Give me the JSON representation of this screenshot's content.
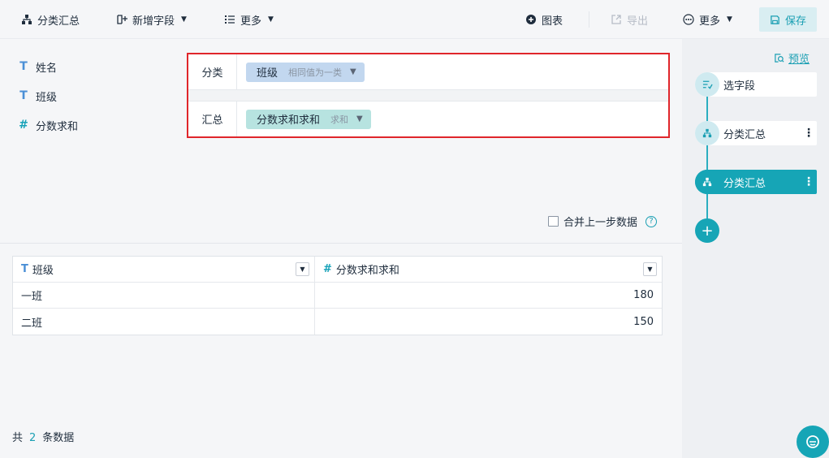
{
  "toolbar": {
    "group_summary": "分类汇总",
    "add_field": "新增字段",
    "more_left": "更多",
    "chart": "图表",
    "export": "导出",
    "more_right": "更多",
    "save": "保存"
  },
  "fields": [
    {
      "type": "T",
      "name": "姓名"
    },
    {
      "type": "T",
      "name": "班级"
    },
    {
      "type": "#",
      "name": "分数求和"
    }
  ],
  "config": {
    "category_label": "分类",
    "category_chip": {
      "name": "班级",
      "mode": "相同值为一类"
    },
    "summary_label": "汇总",
    "summary_chip": {
      "name": "分数求和求和",
      "mode": "求和"
    }
  },
  "merge": {
    "label": "合并上一步数据",
    "help": "?"
  },
  "table": {
    "columns": [
      {
        "type": "T",
        "name": "班级"
      },
      {
        "type": "#",
        "name": "分数求和求和"
      }
    ],
    "rows": [
      [
        "一班",
        "180"
      ],
      [
        "二班",
        "150"
      ]
    ]
  },
  "footer": {
    "prefix": "共",
    "count": "2",
    "suffix": "条数据"
  },
  "right_panel": {
    "preview": "预览",
    "steps": [
      {
        "label": "选字段",
        "active": false
      },
      {
        "label": "分类汇总",
        "active": false
      },
      {
        "label": "分类汇总",
        "active": true
      }
    ],
    "add": "+"
  },
  "colors": {
    "accent": "#16a5b6",
    "highlight_border": "#e0262b",
    "chip_blue": "#c2d7ef",
    "chip_teal": "#b7e3e0"
  }
}
